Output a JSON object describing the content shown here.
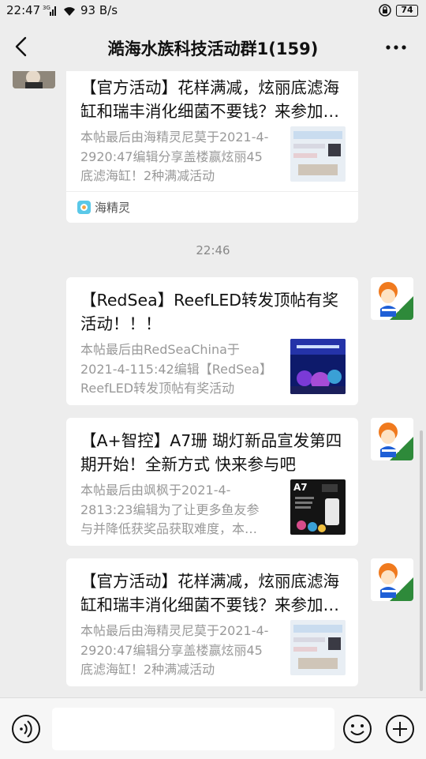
{
  "status_bar": {
    "time": "22:47",
    "network": "3G",
    "speed": "93 B/s",
    "battery": "74"
  },
  "header": {
    "title": "澔海水族科技活动群1(159)",
    "back_icon": "chevron-left-icon",
    "more_icon": "more-dots-icon"
  },
  "messages": [
    {
      "title": "【官方活动】花样满减，炫丽底滤海缸和瑞丰消化细菌不要钱？来参加海精灵盖楼活动吧",
      "description": "本帖最后由海精灵尼莫于2021-4-2920:47编辑分享盖楼赢炫丽45底滤海缸！2种满减活动",
      "source": "海精灵"
    },
    {
      "timestamp": "22:46"
    },
    {
      "title": "【RedSea】ReefLED转发顶帖有奖活动！！！",
      "description": "本帖最后由RedSeaChina于2021-4-115:42编辑【RedSea】ReefLED转发顶帖有奖活动"
    },
    {
      "title": "【A+智控】A7珊 瑚灯新品宣发第四期开始！全新方式  快来参与吧",
      "description": "本帖最后由飒枫于2021-4-2813:23编辑为了让更多鱼友参与并降低获奖品获取难度，本期活动",
      "thumb_label": "A7"
    },
    {
      "title": "【官方活动】花样满减，炫丽底滤海缸和瑞丰消化细菌不要钱？来参加海精灵盖楼活动吧",
      "description": "本帖最后由海精灵尼莫于2021-4-2920:47编辑分享盖楼赢炫丽45底滤海缸！2种满减活动"
    }
  ],
  "input_bar": {
    "voice_icon": "voice-icon",
    "emoji_icon": "emoji-icon",
    "plus_icon": "plus-icon",
    "placeholder": ""
  },
  "colors": {
    "background": "#ededed",
    "card": "#ffffff",
    "secondary_text": "#999999",
    "app_icon": "#5ac8e8"
  }
}
